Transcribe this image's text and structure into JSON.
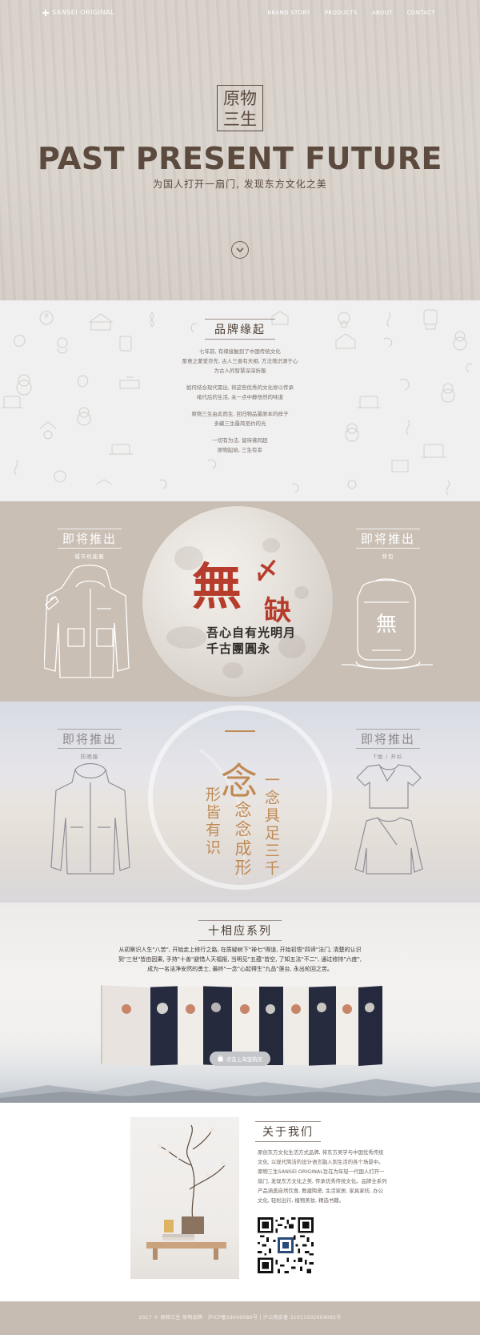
{
  "nav": {
    "logo_text": "SANSEI ORIGINAL",
    "links": [
      "BRAND STORY",
      "PRODUCTS",
      "ABOUT",
      "CONTACT"
    ]
  },
  "hero": {
    "seal_line1": "原物",
    "seal_line2": "三生",
    "title": "PAST PRESENT FUTURE",
    "subtitle": "为国人打开一扇门, 发现东方文化之美",
    "scroll_icon": "chevron-down-icon"
  },
  "origin": {
    "title": "品牌缘起",
    "paragraphs": [
      [
        "七年前, 有缘接触到了中国传统文化",
        "那意之蒙爱亦先, 古人三善有天相, 方法增识源于心",
        "为古人的智慧深深折服"
      ],
      [
        "如何结合现代需出, 将这些优秀的文化修以传承",
        "绪代后的生活, 关一点中静悟然的味道"
      ],
      [
        "原物三生由此而生, 回归物品最原本的样子",
        "多藏三生最简至约的光"
      ],
      [
        "一切有为法, 留待佛同超",
        "原物起始, 三生有幸"
      ]
    ]
  },
  "coming1": {
    "left_title": "即将推出",
    "left_sub": "城市机能服",
    "right_title": "即将推出",
    "right_sub": "背包",
    "calli_main": "無",
    "calli_mark": "〆",
    "calli_que": "缺",
    "poem_line1": "吾心自有光明月",
    "poem_line2": "千古團圓永"
  },
  "coming2": {
    "left_title": "即将推出",
    "left_sub": "防晒服",
    "right_title": "即将推出",
    "right_sub": "T恤 / 开衫",
    "nian_glyph": "念",
    "col1": "一念具足三千",
    "col2": "念念成形",
    "col3": "形皆有识"
  },
  "series": {
    "title": "十相应系列",
    "lines": [
      "从初察识人生\"八苦\", 开始走上修行之路, 在质疑树下\"禅七\"得道, 开始初悟\"四谛\"法门, 清楚的认识",
      "到\"三世\"皆由因果, 手持\"十善\"避惜人天福报, 当明见\"五蕴\"皆空, 了知五法\"不二\", 通过修持\"六度\",",
      "成为一名洁净安然的勇士, 最终\"一念\"心起得生\"九品\"莲台, 永出轮回之苦。"
    ],
    "button_label": "点击上淘宝购买"
  },
  "about": {
    "title": "关于我们",
    "text": "原创东方文化生活方式品牌, 将东方美学与中国优秀传统文化, 以现代简洁的设计语言融入到生活的各个场景中。原物三生SANSEI ORIGINAL旨在为年轻一代国人打开一扇门, 发现东方文化之美, 传承优秀传统文化。品牌全系列产品涵盖自然饮食, 教建陶瓷, 生活家居, 家具家纺, 办公文化, 轻松出行, 植物美妆, 精选书籍。"
  },
  "footer": {
    "text": "2017 © 原物三生 原物品牌 · 沪ICP备18049086号 | 沪公网安备 31011502004095号"
  },
  "colors": {
    "brown": "#5b4a3d",
    "accent_red": "#b63c2b",
    "gold": "#c08a55"
  }
}
